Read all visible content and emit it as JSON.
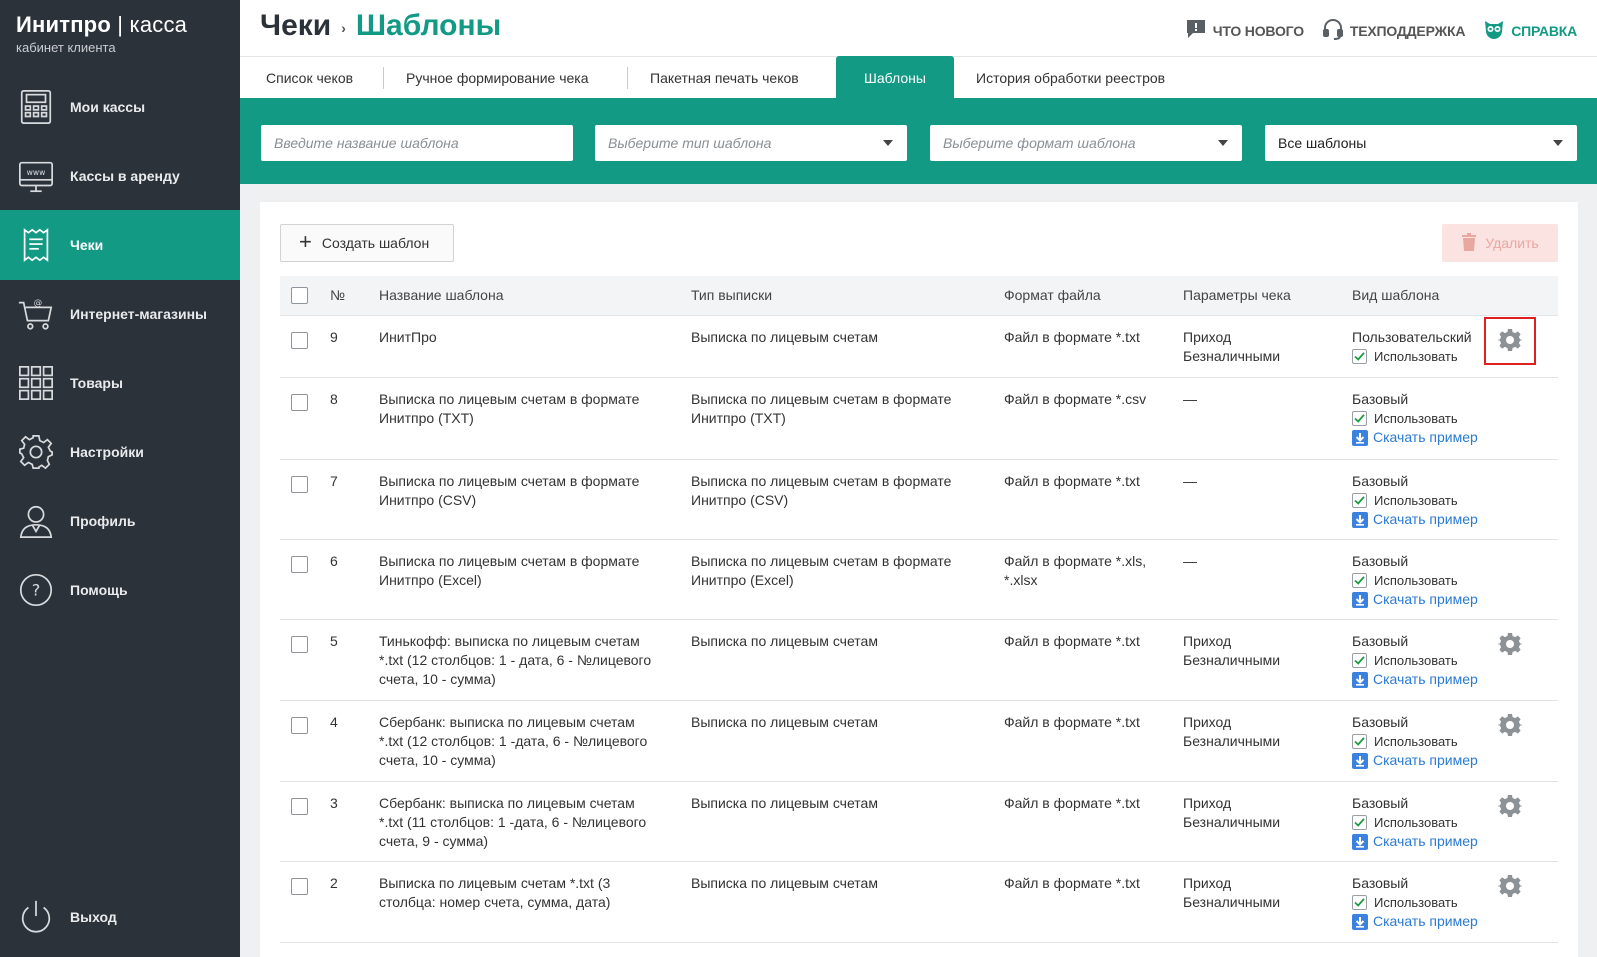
{
  "brand": {
    "name": "Инитпро",
    "sep": " | ",
    "product": "касса",
    "subtitle": "кабинет клиента"
  },
  "sidebar": {
    "items": [
      {
        "label": "Мои кассы",
        "icon": "cash-register-icon"
      },
      {
        "label": "Кассы в аренду",
        "icon": "www-monitor-icon"
      },
      {
        "label": "Чеки",
        "icon": "receipt-icon",
        "active": true
      },
      {
        "label": "Интернет-магазины",
        "icon": "shopping-cart-icon"
      },
      {
        "label": "Товары",
        "icon": "grid-icon"
      },
      {
        "label": "Настройки",
        "icon": "gear-icon"
      },
      {
        "label": "Профиль",
        "icon": "user-icon"
      },
      {
        "label": "Помощь",
        "icon": "question-icon"
      }
    ],
    "logout": "Выход"
  },
  "header": {
    "crumb_root": "Чеки",
    "crumb_sep": "›",
    "crumb_current": "Шаблоны",
    "links": {
      "news": "Что нового",
      "support": "Техподдержка",
      "help": "Справка"
    }
  },
  "tabs": [
    "Список чеков",
    "Ручное формирование чека",
    "Пакетная печать чеков",
    "Шаблоны",
    "История обработки реестров"
  ],
  "filters": {
    "name_placeholder": "Введите название шаблона",
    "type_placeholder": "Выберите тип шаблона",
    "format_placeholder": "Выберите формат шаблона",
    "scope_value": "Все шаблоны"
  },
  "toolbar": {
    "create": "Создать шаблон",
    "delete": "Удалить"
  },
  "table": {
    "headers": {
      "num": "№",
      "name": "Название шаблона",
      "type": "Тип выписки",
      "format": "Формат файла",
      "params": "Параметры чека",
      "kind": "Вид шаблона"
    },
    "use_label": "Использовать",
    "download_label": "Скачать пример",
    "rows": [
      {
        "num": "9",
        "name": [
          "ИнитПро"
        ],
        "type": [
          "Выписка по лицевым счетам"
        ],
        "format": [
          "Файл в формате *.txt"
        ],
        "params": [
          "Приход",
          "Безналичными"
        ],
        "kind": "Пользовательский",
        "download": false,
        "gear": true
      },
      {
        "num": "8",
        "name": [
          "Выписка по лицевым счетам в формате",
          "Инитпро (TXT)"
        ],
        "type": [
          "Выписка по лицевым счетам в формате",
          "Инитпро (TXT)"
        ],
        "format": [
          "Файл в формате *.csv"
        ],
        "params": [
          "—"
        ],
        "kind": "Базовый",
        "download": true,
        "gear": false
      },
      {
        "num": "7",
        "name": [
          "Выписка по лицевым счетам в формате",
          "Инитпро (CSV)"
        ],
        "type": [
          "Выписка по лицевым счетам в формате",
          "Инитпро (CSV)"
        ],
        "format": [
          "Файл в формате *.txt"
        ],
        "params": [
          "—"
        ],
        "kind": "Базовый",
        "download": true,
        "gear": false
      },
      {
        "num": "6",
        "name": [
          "Выписка по лицевым счетам в формате",
          "Инитпро (Excel)"
        ],
        "type": [
          "Выписка по лицевым счетам в формате",
          "Инитпро (Excel)"
        ],
        "format": [
          "Файл в формате *.xls,",
          "*.xlsx"
        ],
        "params": [
          "—"
        ],
        "kind": "Базовый",
        "download": true,
        "gear": false
      },
      {
        "num": "5",
        "name": [
          "Тинькофф: выписка по лицевым счетам",
          "*.txt (12 столбцов: 1 - дата, 6 - №лицевого",
          "счета, 10 - сумма)"
        ],
        "type": [
          "Выписка по лицевым счетам"
        ],
        "format": [
          "Файл в формате *.txt"
        ],
        "params": [
          "Приход",
          "Безналичными"
        ],
        "kind": "Базовый",
        "download": true,
        "gear": true
      },
      {
        "num": "4",
        "name": [
          "Сбербанк: выписка по лицевым счетам",
          "*.txt (12 столбцов: 1 -дата, 6 - №лицевого",
          "счета, 10 - сумма)"
        ],
        "type": [
          "Выписка по лицевым счетам"
        ],
        "format": [
          "Файл в формате *.txt"
        ],
        "params": [
          "Приход",
          "Безналичными"
        ],
        "kind": "Базовый",
        "download": true,
        "gear": true
      },
      {
        "num": "3",
        "name": [
          "Сбербанк: выписка по лицевым счетам",
          "*.txt (11 столбцов: 1 -дата, 6 - №лицевого",
          "счета, 9 - сумма)"
        ],
        "type": [
          "Выписка по лицевым счетам"
        ],
        "format": [
          "Файл в формате *.txt"
        ],
        "params": [
          "Приход",
          "Безналичными"
        ],
        "kind": "Базовый",
        "download": true,
        "gear": true
      },
      {
        "num": "2",
        "name": [
          "Выписка по лицевым счетам *.txt (3",
          "столбца: номер счета, сумма, дата)"
        ],
        "type": [
          "Выписка по лицевым счетам"
        ],
        "format": [
          "Файл в формате *.txt"
        ],
        "params": [
          "Приход",
          "Безналичными"
        ],
        "kind": "Базовый",
        "download": true,
        "gear": true
      }
    ]
  },
  "colors": {
    "accent": "#139a85",
    "sidebar": "#2c323a",
    "link": "#2a7ad6",
    "highlight": "#e01f1f"
  }
}
